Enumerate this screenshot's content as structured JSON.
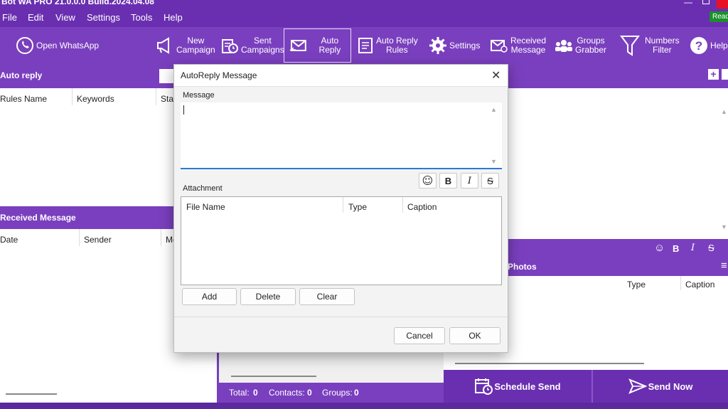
{
  "window": {
    "title": "Bot WA PRO 21.0.0.0 Build.2024.04.08",
    "ready_badge": "Read"
  },
  "menu": [
    "File",
    "Edit",
    "View",
    "Settings",
    "Tools",
    "Help"
  ],
  "toolbar": {
    "open_whatsapp": "Open WhatsApp",
    "new_campaign_1": "New",
    "new_campaign_2": "Campaign",
    "sent_campaigns_1": "Sent",
    "sent_campaigns_2": "Campaigns",
    "auto_reply": "Auto Reply",
    "auto_reply_rules_1": "Auto Reply",
    "auto_reply_rules_2": "Rules",
    "settings": "Settings",
    "received_message_1": "Received",
    "received_message_2": "Message",
    "groups_grabber_1": "Groups",
    "groups_grabber_2": "Grabber",
    "numbers_filter_1": "Numbers",
    "numbers_filter_2": "Filter",
    "help": "Help"
  },
  "auto_reply_panel": {
    "title": "Auto reply",
    "columns": [
      "Rules Name",
      "Keywords",
      "Stat"
    ]
  },
  "received_panel": {
    "title": "Received Message",
    "columns": [
      "Date",
      "Sender",
      "Me"
    ]
  },
  "right_panel": {
    "photos_label": "Photos",
    "columns": [
      "Type",
      "Caption"
    ],
    "format": {
      "bold": "B",
      "italic": "I",
      "strike": "S"
    }
  },
  "status_bar": {
    "total_label": "Total:",
    "total_value": "0",
    "contacts_label": "Contacts:",
    "contacts_value": "0",
    "groups_label": "Groups:",
    "groups_value": "0"
  },
  "actions": {
    "schedule_send": "Schedule Send",
    "send_now": "Send Now"
  },
  "dialog": {
    "title": "AutoReply Message",
    "message_label": "Message",
    "message_value": "",
    "attachment_label": "Attachment",
    "columns": [
      "File Name",
      "Type",
      "Caption"
    ],
    "format": {
      "bold": "B",
      "italic": "I",
      "strike": "S"
    },
    "add": "Add",
    "delete": "Delete",
    "clear": "Clear",
    "cancel": "Cancel",
    "ok": "OK"
  },
  "colors": {
    "primary": "#7a3fbe",
    "dark": "#6a2fb0",
    "ready_badge": "#1a8f2a",
    "close_button": "#e81123"
  }
}
